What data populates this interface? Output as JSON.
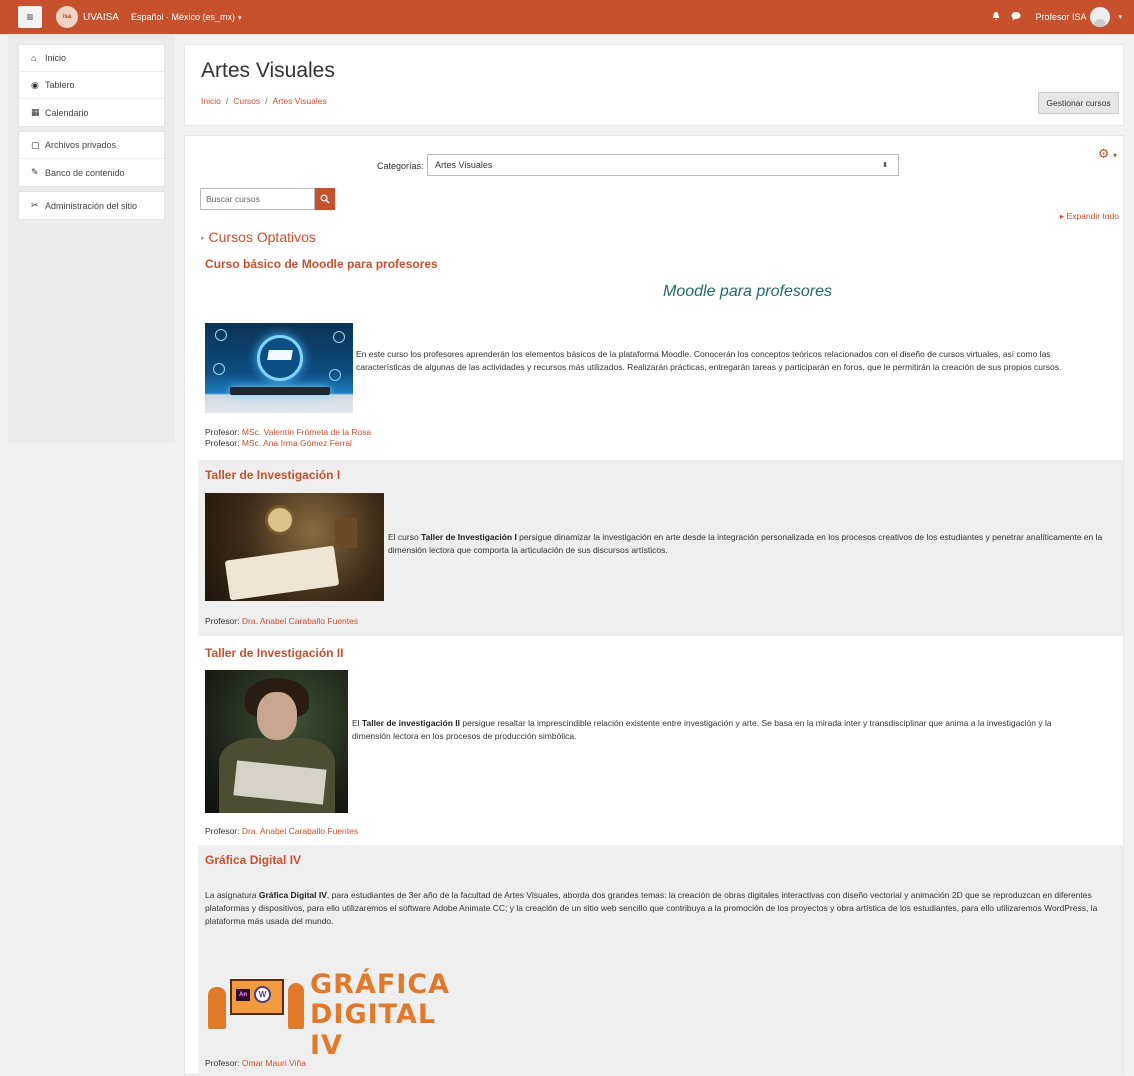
{
  "navbar": {
    "menu_icon": "hamburger-icon",
    "logo_text": "isa",
    "site_name": "UVAISA",
    "language": "Español · México (es_mx)",
    "language_caret": "▾",
    "bell_icon": "bell-icon",
    "chat_icon": "chat-icon",
    "user_name": "Profesor ISA",
    "user_caret": "▾"
  },
  "drawer": {
    "items": [
      {
        "icon": "home-icon",
        "glyph": "⌂",
        "label": "Inicio"
      },
      {
        "icon": "dashboard-icon",
        "glyph": "◉",
        "label": "Tablero"
      },
      {
        "icon": "calendar-icon",
        "glyph": "▦",
        "label": "Calendario"
      },
      {
        "icon": "file-icon",
        "glyph": "▢",
        "label": "Archivos privados"
      },
      {
        "icon": "brush-icon",
        "glyph": "✎",
        "label": "Banco de contenido"
      },
      {
        "icon": "wrench-icon",
        "glyph": "✂",
        "label": "Administración del sitio"
      }
    ]
  },
  "header": {
    "title": "Artes Visuales",
    "breadcrumb": [
      "Inicio",
      "Cursos",
      "Artes Visuales"
    ],
    "breadcrumb_sep": "/",
    "manage_button": "Gestionar cursos"
  },
  "main": {
    "gear_icon": "⚙",
    "gear_caret": "▾",
    "category_label": "Categorías:",
    "category_value": "Artes Visuales",
    "category_arrows": "⬍",
    "search_placeholder": "Buscar cursos",
    "search_button_icon": "⌕",
    "expand_all": "▸ Expandir todo",
    "category_name": "Cursos Optativos",
    "category_triangle": "▸"
  },
  "courses": [
    {
      "title": "Curso básico de Moodle para profesores",
      "heading": "Moodle para profesores",
      "summary": "En este curso los profesores aprenderán los elementos básicos de la plataforma Moodle. Conocerán los conceptos teóricos relacionados con el diseño de cursos virtuales, así como las características de algunas de las actividades y recursos más utilizados. Realizarán prácticas, entregarán tareas y participarán en foros, que le permitirán la creación de sus propios cursos.",
      "teacher_label": "Profesor:",
      "teachers": [
        "MSc. Valentín Frómeta de la Rosa",
        "MSc. Ana Irma Gómez Ferral"
      ]
    },
    {
      "title": "Taller de Investigación I",
      "summary_pre": "El curso ",
      "summary_bold": "Taller de Investigación I",
      "summary_post": " persigue dinamizar la investigación en arte desde la integración personalizada en los procesos creativos de los estudiantes y penetrar analíticamente en la dimensión lectora que comporta la articulación de sus discursos artísticos.",
      "teacher_label": "Profesor:",
      "teachers": [
        "Dra. Anabel Caraballo Fuentes"
      ]
    },
    {
      "title": "Taller de Investigación II",
      "summary_pre": "El ",
      "summary_bold": "Taller de investigación II",
      "summary_post": " persigue resaltar la imprescindible relación existente entre investigación y arte. Se basa en la mirada inter y transdisciplinar que anima a la investigación y la dimensión lectora en los procesos de producción simbólica.",
      "teacher_label": "Profesor:",
      "teachers": [
        "Dra. Anabel Caraballo Fuentes"
      ]
    },
    {
      "title": "Gráfica Digital IV",
      "summary_pre": "La asignatura ",
      "summary_bold": "Gráfica Digital IV",
      "summary_post": ", para estudiantes de 3er año de la facultad de Artes Visuales, aborda dos grandes temas: la creación de obras digitales interactivas con diseño vectorial y animación 2D que se reproduzcan en diferentes plataformas y dispositivos, para ello utilizaremos el software Adobe Animate CC; y la creación de un sitio web sencillo que contribuya a la promoción de los proyectos y obra artística de los estudiantes, para ello utilizaremos WordPress, la plataforma más usada del mundo.",
      "logo_line1": "GRÁFICA",
      "logo_line2": "DIGITAL IV",
      "logo_an": "An",
      "logo_wp": "W",
      "teacher_label": "Profesor:",
      "teachers": [
        "Omar Mauri Viña"
      ]
    }
  ],
  "colors": {
    "brand": "#c8512d",
    "heading_teal": "#216a6a"
  }
}
